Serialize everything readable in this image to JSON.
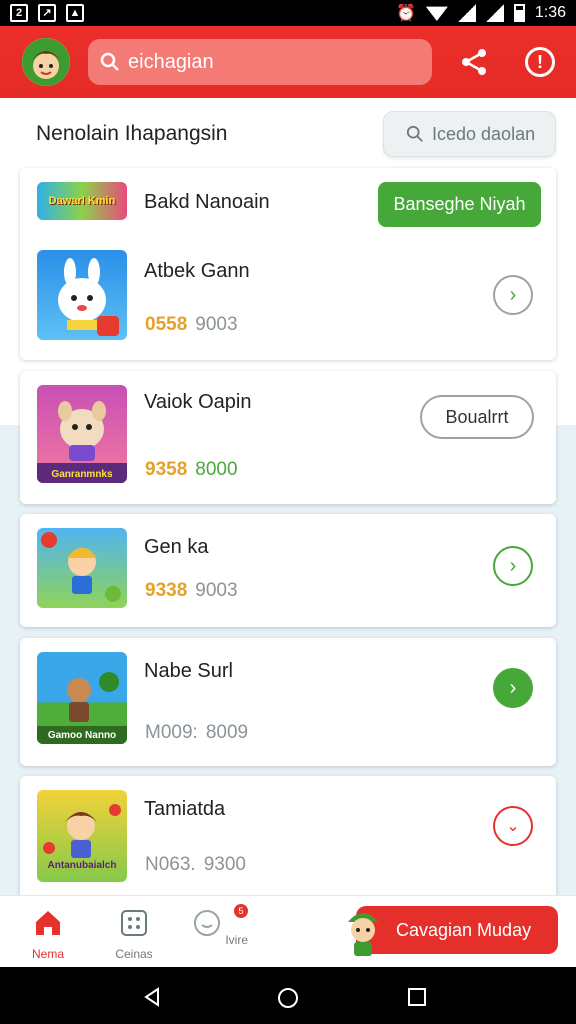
{
  "status_bar": {
    "time": "1:36"
  },
  "app_bar": {
    "search_text": "eichagian"
  },
  "section": {
    "title": "Nenolain Ihapangsin",
    "filter_label": "Icedo daolan"
  },
  "promo_row": {
    "thumb_text": "Dawarl Kmin",
    "name": "Bakd Nanoain",
    "button_label": "Banseghe Niyah"
  },
  "games": [
    {
      "name": "Atbek Gann",
      "price": "0558",
      "meta": "9003",
      "price_color": "#e5a12a",
      "meta_color": "#8b9499",
      "action": "arrow-outline-gray"
    },
    {
      "name": "Vaiok Oapin",
      "price": "9358",
      "meta": "8000",
      "price_color": "#e5a12a",
      "meta_color": "#4aa83a",
      "action": "button",
      "button_label": "Boualrrt",
      "thumb_text": "Ganranmnks"
    },
    {
      "name": "Gen ka",
      "price": "9338",
      "meta": "9003",
      "price_color": "#e5a12a",
      "meta_color": "#8b9499",
      "action": "arrow-outline-green"
    },
    {
      "name": "Nabe Surl",
      "price": "M009:",
      "meta": "8009",
      "price_color": "#8b9499",
      "meta_color": "#8b9499",
      "action": "arrow-filled-green",
      "thumb_text": "Gamoo Nanno"
    },
    {
      "name": "Tamiatda",
      "price": "N063.",
      "meta": "9300",
      "price_color": "#8b9499",
      "meta_color": "#8b9499",
      "action": "arrow-outline-red",
      "thumb_text": "Antanubaialch"
    }
  ],
  "bottom_nav": {
    "items": [
      {
        "label": "Nema",
        "icon": "home-icon",
        "active": true
      },
      {
        "label": "Ceinas",
        "icon": "games-icon"
      },
      {
        "label": "Ivire",
        "icon": "notification-icon",
        "badge": "5"
      }
    ],
    "cta_label": "Cavagian Muday"
  },
  "colors": {
    "brand_red": "#e52b25",
    "accent_green": "#46a838"
  }
}
